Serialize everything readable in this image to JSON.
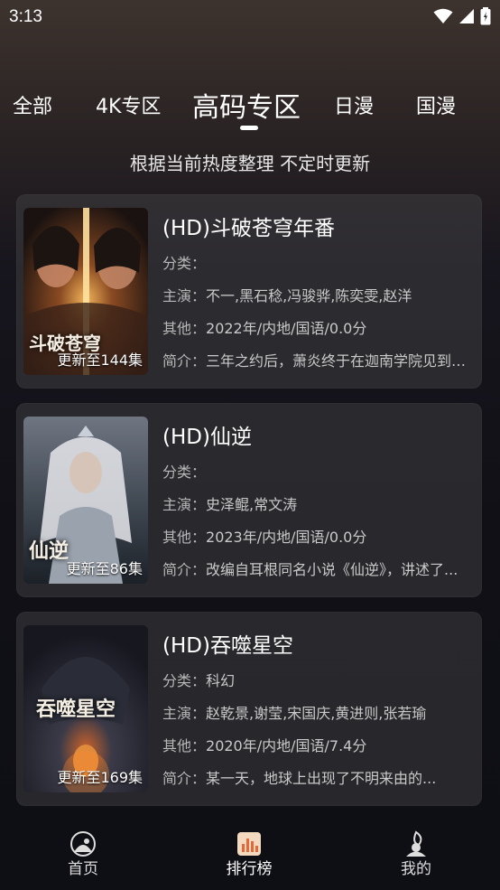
{
  "status_bar": {
    "time": "3:13"
  },
  "tabs": [
    {
      "label": "全部"
    },
    {
      "label": "4K专区"
    },
    {
      "label": "高码专区"
    },
    {
      "label": "日漫"
    },
    {
      "label": "国漫"
    }
  ],
  "subtitle": "根据当前热度整理 不定时更新",
  "labels": {
    "category": "分类：",
    "cast": "主演：",
    "other": "其他：",
    "intro": "简介："
  },
  "items": [
    {
      "title": "(HD)斗破苍穹年番",
      "category": "",
      "cast": "不一,黑石稔,冯骏骅,陈奕雯,赵洋",
      "other": "2022年/内地/国语/0.0分",
      "intro": "三年之约后，萧炎终于在迦南学院见到了...",
      "badge": "更新至144集",
      "poster_logo": "斗破苍穹"
    },
    {
      "title": "(HD)仙逆",
      "category": "",
      "cast": "史泽鲲,常文涛",
      "other": "2023年/内地/国语/0.0分",
      "intro": "改编自耳根同名小说《仙逆》，讲述了...",
      "badge": "更新至86集",
      "poster_logo": "仙逆"
    },
    {
      "title": "(HD)吞噬星空",
      "category": "科幻",
      "cast": "赵乾景,谢莹,宋国庆,黄进则,张若瑜",
      "other": "2020年/内地/国语/7.4分",
      "intro": "某一天，地球上出现了不明来由的...",
      "badge": "更新至169集",
      "poster_logo": "吞噬星空"
    }
  ],
  "bottom_nav": [
    {
      "label": "首页",
      "icon": "home-icon"
    },
    {
      "label": "排行榜",
      "icon": "ranking-icon"
    },
    {
      "label": "我的",
      "icon": "profile-icon"
    }
  ],
  "colors": {
    "active_nav": "#f0a060",
    "background": "#101016"
  }
}
